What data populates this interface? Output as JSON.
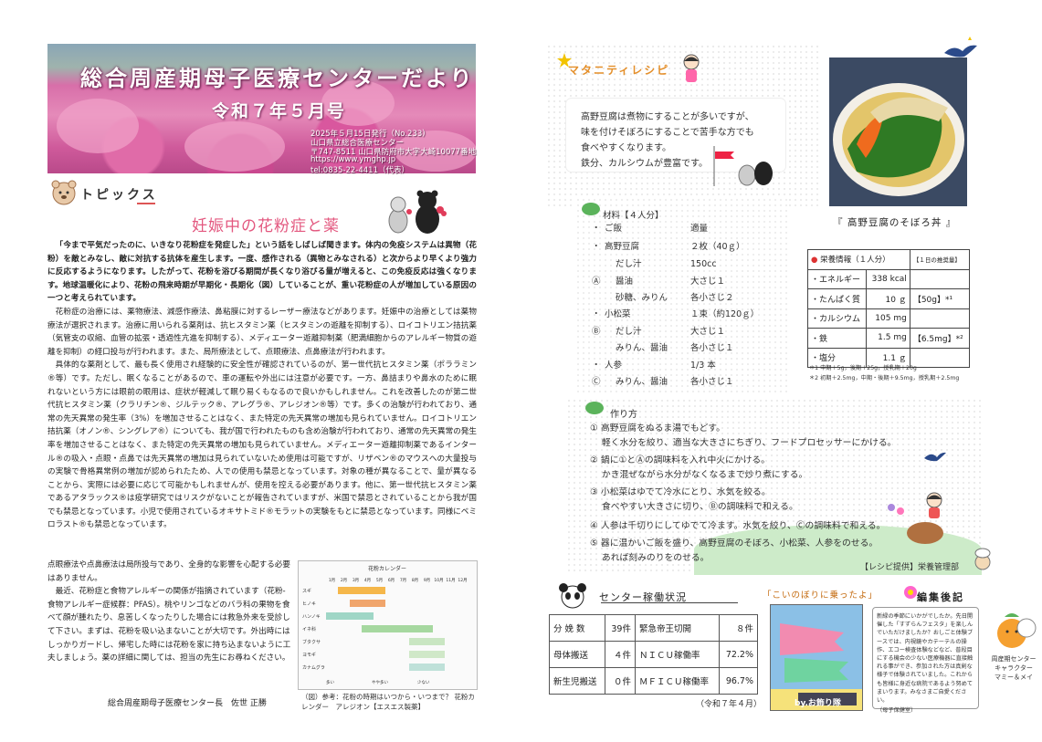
{
  "header": {
    "title": "総合周産期母子医療センターだより",
    "issue": "令和７年５月号",
    "info": [
      "2025年５月15日発行（No.233）",
      "山口県立総合医療センター",
      "〒747-8511 山口県防府市大字大崎10077番地",
      "https://www.ymghp.jp",
      "tel:0835-22-4411（代表）"
    ]
  },
  "topics": {
    "label": "トピックス",
    "title": "妊娠中の花粉症と薬",
    "paragraphs": [
      "「今まで平気だったのに、いきなり花粉症を発症した」という話をしばしば聞きます。体内の免疫システムは異物（花粉）を敵とみなし、敵に対抗する抗体を産生します。一度、感作される（異物とみなされる）と次からより早くより強力に反応するようになります。したがって、花粉を浴びる期間が長くなり浴びる量が増えると、この免疫反応は強くなります。地球温暖化により、花粉の飛来時期が早期化・長期化（図）していることが、重い花粉症の人が増加している原因の一つと考えられています。",
      "花粉症の治療には、薬物療法、減感作療法、鼻粘膜に対するレーザー療法などがあります。妊娠中の治療としては薬物療法が選択されます。治療に用いられる薬剤は、抗ヒスタミン薬（ヒスタミンの遊離を抑制する）、ロイコトリエン拮抗薬（気管支の収縮、血管の拡張・透過性亢進を抑制する）、メディエーター遊離抑制薬（肥満細胞からのアレルギー物質の遊離を抑制）の経口投与が行われます。また、局所療法として、点眼療法、点鼻療法が行われます。",
      "具体的な薬剤として、最も長く使用され経験的に安全性が確認されているのが、第一世代抗ヒスタミン薬（ポララミン®等）です。ただし、眠くなることがあるので、車の運転や外出には注意が必要です。一方、鼻詰まりや鼻水のために眠れないという方には眼前の眼用は、症状が軽減して眠り易くもなるので良いかもしれません。これを改善したのが第二世代抗ヒスタミン薬（クラリチン®、ジルテック®、アレグラ®、アレジオン®等）です。多くの治験が行われており、通常の先天異常の発生率（3%）を増加させることはなく、また特定の先天異常の増加も見られていません。ロイコトリエン拮抗薬（オノン®、シングレア®）についても、我が国で行われたものも含め治験が行われており、通常の先天異常の発生率を増加させることはなく、また特定の先天異常の増加も見られていません。メディエーター遊離抑制薬であるインタール®の吸入・点眼・点鼻では先天異常の増加は見られていないため使用は可能ですが、リザベン®のマウスへの大量投与の実験で骨格異常例の増加が認められたため、人での使用も禁忌となっています。対象の種が異なることで、量が異なることから、実際には必要に応じて可能かもしれませんが、使用を控える必要があります。他に、第一世代抗ヒスタミン薬であるアタラックス®は疫学研究ではリスクがないことが報告されていますが、米国で禁忌とされていることから我が国でも禁忌となっています。小児で使用されているオキサトミド®モラットの実験をもとに禁忌となっています。同様にベミロラスト®も禁忌となっています。"
    ],
    "narrow_paragraphs": [
      "点眼療法や点鼻療法は局所投与であり、全身的な影響を心配する必要はありません。",
      "最近、花粉症と食物アレルギーの関係が指摘されています（花粉-食物アレルギー症候群：PFAS）。桃やリンゴなどのバラ科の果物を食べて顔が腫れたり、息苦しくなったりした場合には救急外来を受診して下さい。まずは、花粉を吸い込まないことが大切です。外出時にはしっかりガードし、帰宅した時には花粉を家に持ち込まないように工夫しましょう。薬の詳細に関しては、担当の先生にお尋ねください。"
    ],
    "author": "総合周産期母子医療センター長　佐世 正勝",
    "chart_caption": "（図）参考：花粉の時期はいつから・いつまで？ 花粉カレンダー　アレジオン【エスエス製薬】"
  },
  "pollen_chart": {
    "title": "花粉カレンダー",
    "months": [
      "1月",
      "2月",
      "3月",
      "4月",
      "5月",
      "6月",
      "7月",
      "8月",
      "9月",
      "10月",
      "11月",
      "12月"
    ],
    "rows": [
      "スギ",
      "ヒノキ",
      "ハンノキ",
      "イネ科",
      "ブタクサ",
      "ヨモギ",
      "カナムグラ"
    ],
    "legend": [
      "多い",
      "やや多い",
      "少ない"
    ]
  },
  "macro": {
    "label": "マタニティレシピ",
    "lines": [
      "高野豆腐は煮物にすることが多いですが、",
      "味を付けそぼろにすることで苦手な方でも",
      "食べやすくなります。",
      "鉄分、カルシウムが豊富です。"
    ],
    "dish_title": "『 高野豆腐のそぼろ丼 』"
  },
  "ingredients": {
    "label": "材料【４人分】",
    "rows": [
      {
        "mark": "・",
        "name": "ご飯",
        "amount": "適量"
      },
      {
        "mark": "・",
        "name": "高野豆腐",
        "amount": "２枚（40ｇ）"
      },
      {
        "mark": "",
        "name": "だし汁",
        "amount": "150cc"
      },
      {
        "mark": "Ⓐ",
        "name": "醤油",
        "amount": "大さじ１"
      },
      {
        "mark": "",
        "name": "砂糖、みりん",
        "amount": "各小さじ２"
      },
      {
        "mark": "・",
        "name": "小松菜",
        "amount": "１束（約120ｇ）"
      },
      {
        "mark": "Ⓑ",
        "name": "だし汁",
        "amount": "大さじ１"
      },
      {
        "mark": "",
        "name": "みりん、醤油",
        "amount": "各小さじ１"
      },
      {
        "mark": "・",
        "name": "人参",
        "amount": "1/3 本"
      },
      {
        "mark": "Ⓒ",
        "name": "みりん、醤油",
        "amount": "各小さじ１"
      }
    ]
  },
  "nutrition": {
    "header": "栄養情報（１人分）",
    "header_right": "【１日の推奨量】",
    "rows": [
      {
        "name": "・エネルギー",
        "value": "338 kcal",
        "rec": ""
      },
      {
        "name": "・たんぱく質",
        "value": "10 ｇ",
        "rec": "【50g】*¹"
      },
      {
        "name": "・カルシウム",
        "value": "105 mg",
        "rec": ""
      },
      {
        "name": "・鉄",
        "value": "1.5 mg",
        "rec": "【6.5mg】*²"
      },
      {
        "name": "・塩分",
        "value": "1.1 ｇ",
        "rec": ""
      }
    ],
    "notes": [
      "＊1 中期＋5g，後期＋25g，授乳期＋20g",
      "＊2 初期＋2.5mg，中期・後期＋9.5mg，授乳期＋2.5mg"
    ]
  },
  "method": {
    "label": "作り方",
    "steps": [
      "① 高野豆腐をぬるま湯でもどす。",
      "　 軽く水分を絞り、適当な大きさにちぎり、フードプロセッサーにかける。",
      "② 鍋に①とⒶの調味料を入れ中火にかける。",
      "　 かき混ぜながら水分がなくなるまで炒り煮にする。",
      "③ 小松菜はゆでて冷水にとり、水気を絞る。",
      "　 食べやすい大きさに切り、Ⓑの調味料で和える。",
      "④ 人参は千切りにしてゆでて冷ます。水気を絞り、Ⓒの調味料で和える。",
      "⑤ 器に温かいご飯を盛り、高野豆腐のそぼろ、小松菜、人参をのせる。",
      "　 あれば刻みのりをのせる。"
    ],
    "credit": "【レシピ提供】栄養管理部"
  },
  "status": {
    "label": "センター稼働状況",
    "rows": [
      {
        "k1": "分 娩 数",
        "v1": "39件",
        "k2": "緊急帝王切開",
        "v2": "８件"
      },
      {
        "k1": "母体搬送",
        "v1": "４件",
        "k2": "ＮＩＣＵ稼働率",
        "v2": "72.2%"
      },
      {
        "k1": "新生児搬送",
        "v1": "０件",
        "k2": "ＭＦＩＣＵ稼働率",
        "v2": "96.7%"
      }
    ],
    "note": "（令和７年４月）"
  },
  "koinobori": {
    "title": "「こいのぼりに乗ったよ」",
    "tag": "by.お飾り隊"
  },
  "editor": {
    "label": "編集後記",
    "text": "新緑の季節にいかがでしたか。先日開催した「すずらんフェスタ」を楽しんでいただけましたか？おしごと体験ブースでは、内視鏡やカテーテルの操作、エコー検査体験などなど、普段目にする機会の少ない医療機器に直接触れる事ができ、参加された方は真剣な様子で体験されていました。これからも皆様に身近な病院であるよう努めてまいります。みなさまご自愛ください。",
    "signature": "（母子保健室）",
    "mascot": [
      "周産期センター",
      "キャラクター",
      "マミー＆メイ"
    ]
  }
}
